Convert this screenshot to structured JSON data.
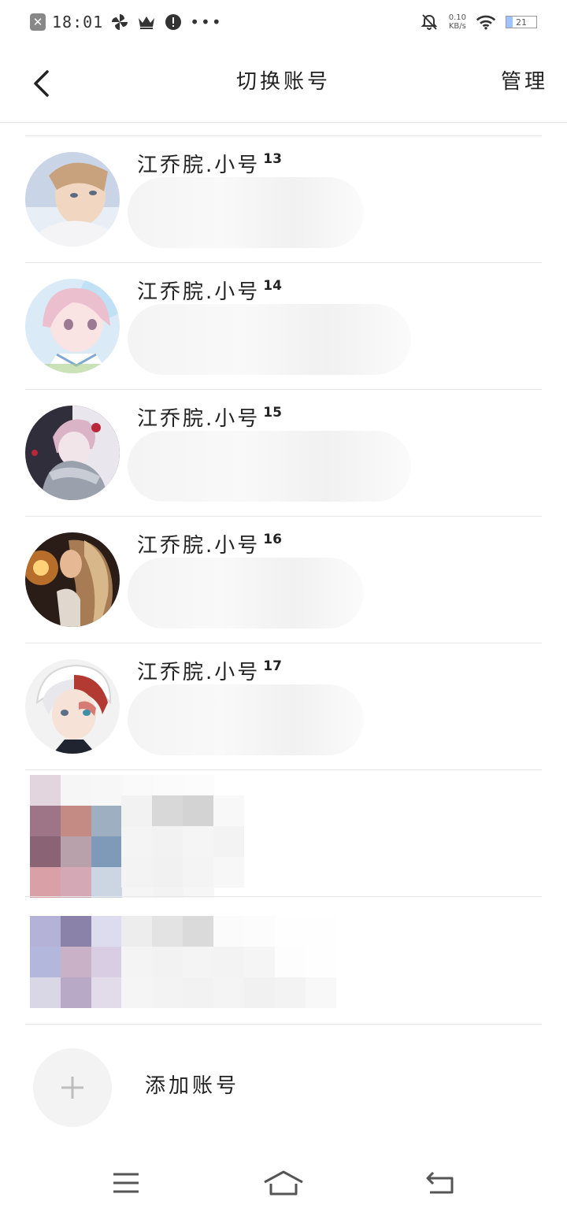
{
  "status_bar": {
    "time": "18:01",
    "network_speed_value": "0.10",
    "network_speed_unit": "KB/s",
    "battery_level": "21"
  },
  "header": {
    "title": "切换账号",
    "manage_label": "管理"
  },
  "accounts": [
    {
      "name": "江乔脘.小号",
      "badge": "13"
    },
    {
      "name": "江乔脘.小号",
      "badge": "14"
    },
    {
      "name": "江乔脘.小号",
      "badge": "15"
    },
    {
      "name": "江乔脘.小号",
      "badge": "16"
    },
    {
      "name": "江乔脘.小号",
      "badge": "17"
    }
  ],
  "add_account": {
    "label": "添加账号"
  },
  "colors": {
    "divider": "#e6e6e6",
    "text": "#222222",
    "add_circle": "#f3f3f3"
  },
  "icons": [
    "close-icon",
    "pinwheel-icon",
    "crown-icon",
    "alert-icon",
    "more-icon",
    "bell-off-icon",
    "wifi-icon",
    "battery-icon",
    "back-arrow-icon",
    "plus-icon",
    "menu-icon",
    "home-icon",
    "return-icon"
  ]
}
